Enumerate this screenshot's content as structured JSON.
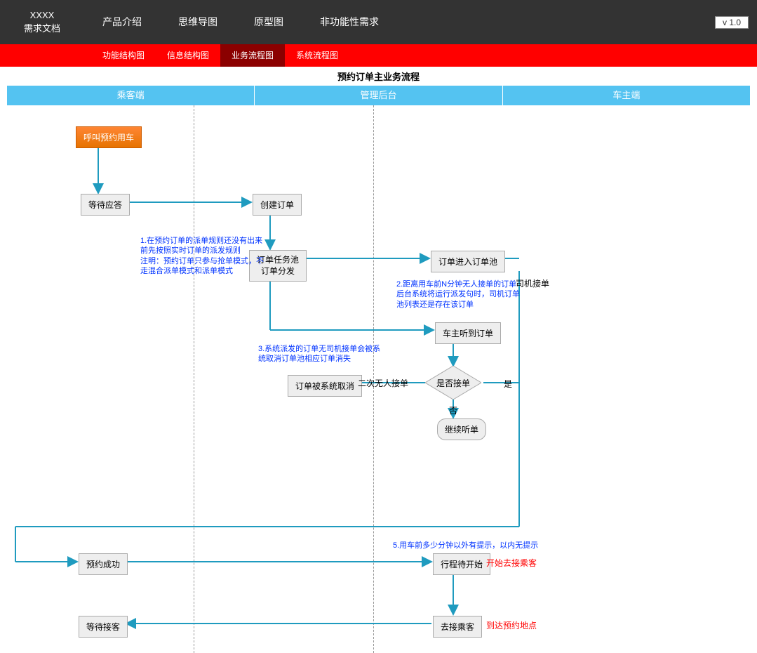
{
  "logo_line1": "XXXX",
  "logo_line2": "需求文档",
  "topnav": [
    "产品介绍",
    "思维导图",
    "原型图",
    "非功能性需求"
  ],
  "version": "v 1.0",
  "subnav": [
    "功能结构图",
    "信息结构图",
    "业务流程图",
    "系统流程图"
  ],
  "subnav_active": 2,
  "diagram_title": "预约订单主业务流程",
  "lanes": [
    "乘客端",
    "管理后台",
    "车主端"
  ],
  "nodes": {
    "start": "呼叫预约用车",
    "wait_reply": "等待应答",
    "create_order": "创建订单",
    "task_pool_line1": "订单任务池",
    "task_pool_line2": "订单分发",
    "enter_pool": "订单进入订单池",
    "driver_hear": "车主听到订单",
    "decision": "是否接单",
    "continue_listen": "继续听单",
    "sys_cancel": "订单被系统取消",
    "reserve_ok": "预约成功",
    "trip_wait": "行程待开始",
    "wait_pickup": "等待接客",
    "go_pickup": "去接乘客"
  },
  "labels": {
    "driver_accept": "司机接单",
    "yes": "是",
    "no": "否",
    "twice_noone": "二次无人接单"
  },
  "notes": {
    "n1": "1.在预约订单的派单规则还没有出来前先按照实时订单的派发规则\n注明：预约订单只参与抢单模式，不走混合派单模式和派单模式",
    "n2": "2.距离用车前N分钟无人接单的订单后台系统将运行派发句时，司机订单池列表还是存在该订单",
    "n3": "3.系统派发的订单无司机接单会被系统取消订单池相应订单消失",
    "n5": "5.用车前多少分钟以外有提示，以内无提示"
  },
  "rednotes": {
    "start_pickup": "开始去接乘客",
    "arrive_point": "到达预约地点"
  }
}
